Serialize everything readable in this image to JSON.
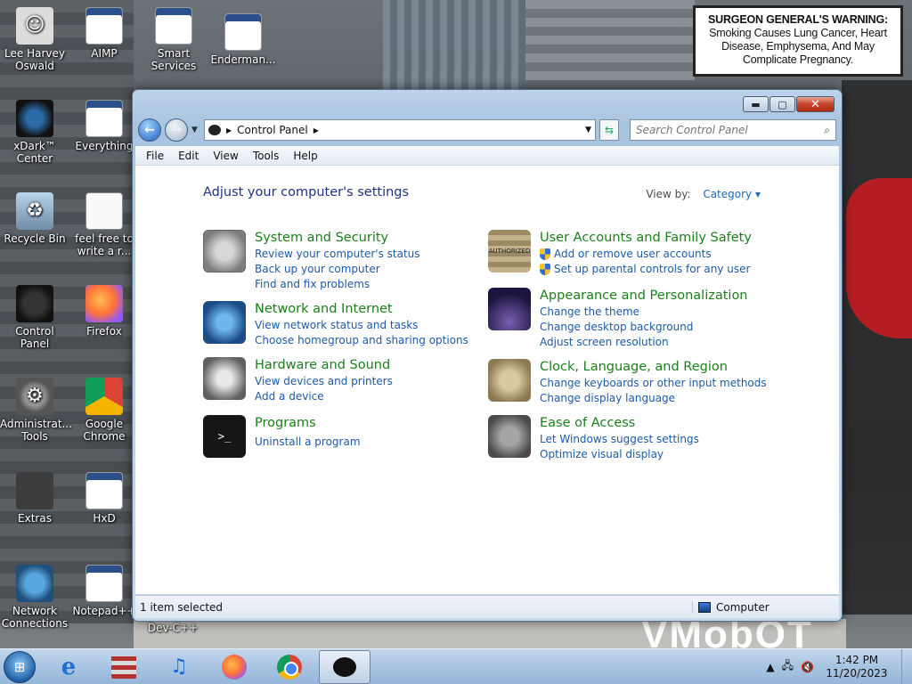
{
  "wallpaper": {
    "warning_bold": "SURGEON GENERAL'S WARNING:",
    "warning_rest": "Smoking Causes Lung Cancer, Heart Disease, Emphysema, And May Complicate Pregnancy.",
    "vmobot": "VMobOT"
  },
  "desktop": {
    "icons": [
      {
        "label": "Lee Harvey Oswald",
        "icon": "person-icon"
      },
      {
        "label": "AIMP",
        "icon": "app-icon"
      },
      {
        "label": "Smart Services",
        "icon": "app-icon"
      },
      {
        "label": "Enderman...",
        "icon": "app-icon"
      },
      {
        "label": "xDark™ Center",
        "icon": "xdark-icon"
      },
      {
        "label": "Everything",
        "icon": "app-icon"
      },
      {
        "label": "Recycle Bin",
        "icon": "recycle-bin-icon"
      },
      {
        "label": "feel free to write a r...",
        "icon": "document-icon"
      },
      {
        "label": "Control Panel",
        "icon": "control-panel-icon"
      },
      {
        "label": "Firefox",
        "icon": "firefox-icon"
      },
      {
        "label": "Administrat... Tools",
        "icon": "gear-icon"
      },
      {
        "label": "Google Chrome",
        "icon": "chrome-icon"
      },
      {
        "label": "Extras",
        "icon": "folder-icon"
      },
      {
        "label": "HxD",
        "icon": "app-icon"
      },
      {
        "label": "Network Connections",
        "icon": "network-icon"
      },
      {
        "label": "Notepad++",
        "icon": "app-icon"
      },
      {
        "label": "Dev-C++",
        "icon": "app-icon"
      }
    ]
  },
  "window": {
    "address": {
      "root_icon": "control-panel-icon",
      "crumb": "Control Panel"
    },
    "search_placeholder": "Search Control Panel",
    "menu": [
      "File",
      "Edit",
      "View",
      "Tools",
      "Help"
    ],
    "heading": "Adjust your computer's settings",
    "view_by_label": "View by:",
    "view_by_value": "Category",
    "categories": [
      {
        "title": "System and Security",
        "links": [
          "Review your computer's status",
          "Back up your computer",
          "Find and fix problems"
        ]
      },
      {
        "title": "Network and Internet",
        "links": [
          "View network status and tasks",
          "Choose homegroup and sharing options"
        ]
      },
      {
        "title": "Hardware and Sound",
        "links": [
          "View devices and printers",
          "Add a device"
        ]
      },
      {
        "title": "Programs",
        "links": [
          "Uninstall a program"
        ]
      },
      {
        "title": "User Accounts and Family Safety",
        "links": [
          "Add or remove user accounts",
          "Set up parental controls for any user"
        ]
      },
      {
        "title": "Appearance and Personalization",
        "links": [
          "Change the theme",
          "Change desktop background",
          "Adjust screen resolution"
        ]
      },
      {
        "title": "Clock, Language, and Region",
        "links": [
          "Change keyboards or other input methods",
          "Change display language"
        ]
      },
      {
        "title": "Ease of Access",
        "links": [
          "Let Windows suggest settings",
          "Optimize visual display"
        ]
      }
    ],
    "status_left": "1 item selected",
    "status_right": "Computer",
    "icon_labels": {
      "prog": ">_",
      "user": "AUTHORIZED"
    }
  },
  "taskbar": {
    "time": "1:42 PM",
    "date": "11/20/2023"
  }
}
